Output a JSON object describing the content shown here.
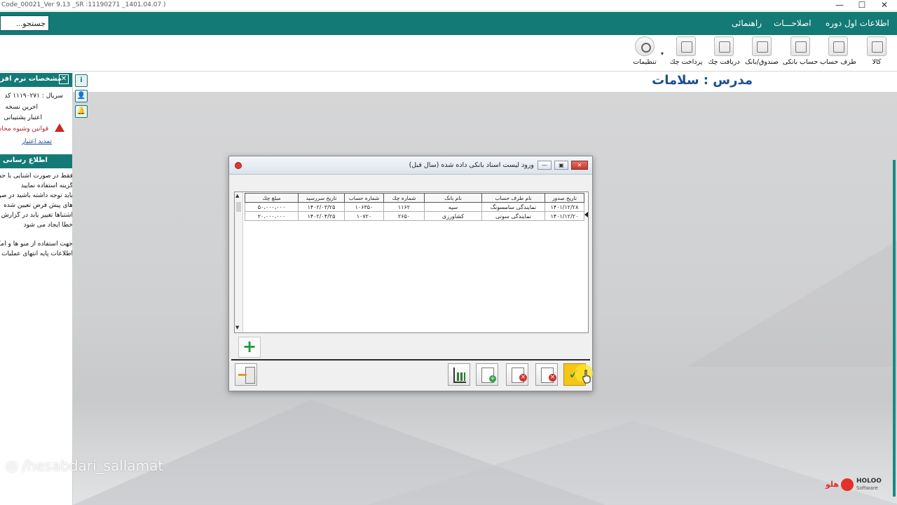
{
  "window": {
    "title": "Code_00021_Ver 9.13 _SR :11190271 _1401.04.07 )",
    "min_glyph": "—",
    "max_glyph": "☐",
    "close_glyph": "✕"
  },
  "search": {
    "value": "جستجو..."
  },
  "menu": [
    "اطلاعات اول دوره",
    "اصلاحـــات",
    "راهنمائی"
  ],
  "toolbar": {
    "items": [
      {
        "label": "کالا",
        "icon": "box-icon"
      },
      {
        "label": "طرف حساب",
        "icon": "person-icon"
      },
      {
        "label": "حساب بانکی",
        "icon": "bank-icon"
      },
      {
        "label": "صندوق/بانک",
        "icon": "cash-box-icon"
      },
      {
        "label": "دریافت چك",
        "icon": "check-receive-icon"
      },
      {
        "label": "پرداخت چك",
        "icon": "check-pay-icon"
      },
      {
        "label": "تنظیمات",
        "icon": "gear-icon"
      }
    ],
    "dropdown_glyph": "▾"
  },
  "heading": "مدرس : سلامات",
  "sidepanel": {
    "title": "مشخصات نرم افزار",
    "close_glyph": "✕",
    "lines": [
      "سریال : ۱۱۱۹۰۲۷۱ کد",
      "آخرین نسخه",
      "اعتبار پشتیبانی"
    ],
    "warning": "قوانین وشیوه محاسبه",
    "renew_link": "تمدید اعتبار",
    "info_title": "اطلاع رسانی",
    "info_lines": [
      "فقط در صورت آشنایی با حسابداری",
      "گزینه استفاده نمایید",
      "باید توجه داشته باشید در صورت",
      "های پیش فرض تعیین شده",
      "اشتباها تغییر یابد در گزارش",
      "خطا ایجاد می شود",
      "جهت استفاده از منو ها و امکانات",
      "اطلاعات پایه انتهای عملیات را"
    ],
    "side_buttons": [
      "i",
      "👤",
      "🔔"
    ]
  },
  "dialog": {
    "title": "ورود لیست اسناد بانکی داده شده (سال قبل)",
    "buttons": [
      "—",
      "▣",
      "✕"
    ],
    "columns": [
      "تاریخ صدور",
      "نام طرف حساب",
      "نام بانک",
      "شماره چك",
      "شماره حساب",
      "تاریخ سررسید",
      "مبلغ چك"
    ],
    "rows": [
      [
        "۱۴۰۱/۱۲/۲۸",
        "نمایندگی سامسونگ",
        "سپه",
        "۱۱۶۲",
        "۱۰۶۳۵۰",
        "۱۴۰۲/۰۳/۲۵",
        "۵۰،۰۰۰،۰۰۰"
      ],
      [
        "۱۴۰۱/۱۲/۲۰",
        "نمایندگی سونی",
        "کشاورزی",
        "۲۶۵۰",
        "۱۰۷۲۰",
        "۱۴۰۲/۰۴/۲۵",
        "۲۰،۰۰۰،۰۰۰"
      ]
    ],
    "add_glyph": "+",
    "footer_buttons": [
      {
        "name": "confirm-button",
        "icon": "checkmark-icon"
      },
      {
        "name": "delete-button",
        "icon": "document-delete-icon"
      },
      {
        "name": "delete-all-button",
        "icon": "document-delete-icon"
      },
      {
        "name": "add-person-button",
        "icon": "user-add-icon"
      },
      {
        "name": "chart-button",
        "icon": "bar-chart-icon"
      },
      {
        "name": "exit-button",
        "icon": "exit-door-icon"
      }
    ]
  },
  "watermark": "/hesabdari_sallamat",
  "brand": {
    "fa": "هلو",
    "en": "HOLOO",
    "sub": "Software"
  },
  "colors": {
    "accent": "#147a76",
    "heading": "#1b4f8f",
    "confirm": "#f5c518",
    "brand": "#e4312b"
  }
}
